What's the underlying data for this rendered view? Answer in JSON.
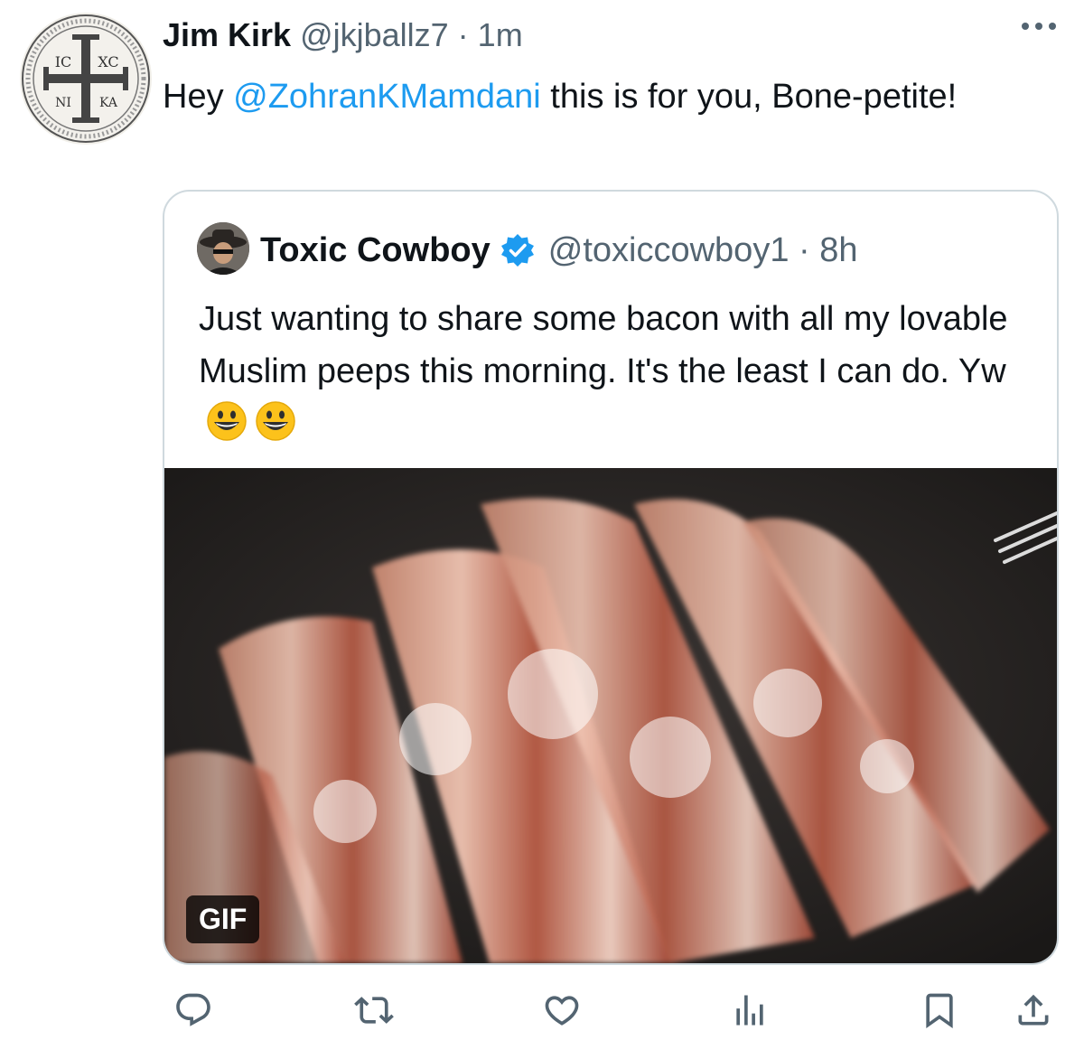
{
  "author": {
    "name": "Jim Kirk",
    "meta": "@jkjballz7 · 1m",
    "avatar_icon": "byzantine-cross-seal-icon",
    "avatar_glyphs": [
      "IC",
      "XC",
      "NI",
      "KA"
    ]
  },
  "tweet": {
    "text_before": "Hey ",
    "mention": "@ZohranKMamdani",
    "text_after": " this is for you, Bone-petite!"
  },
  "quoted": {
    "name": "Toxic Cowboy",
    "meta": "@toxiccowboy1 · 8h",
    "verified_icon": "verified-badge-icon",
    "text": "Just wanting to share some bacon with all my lovable Muslim peeps this morning. It's the least I can do. Yw",
    "emojis": [
      "grinning-face-emoji",
      "grinning-face-emoji"
    ],
    "media_badge": "GIF"
  },
  "actions": [
    "reply-icon",
    "retweet-icon",
    "like-icon",
    "analytics-icon",
    "bookmark-icon",
    "share-icon"
  ],
  "colors": {
    "accent": "#1d9bf0",
    "text": "#0f1419",
    "secondary": "#536471",
    "border": "#cfd9de"
  }
}
